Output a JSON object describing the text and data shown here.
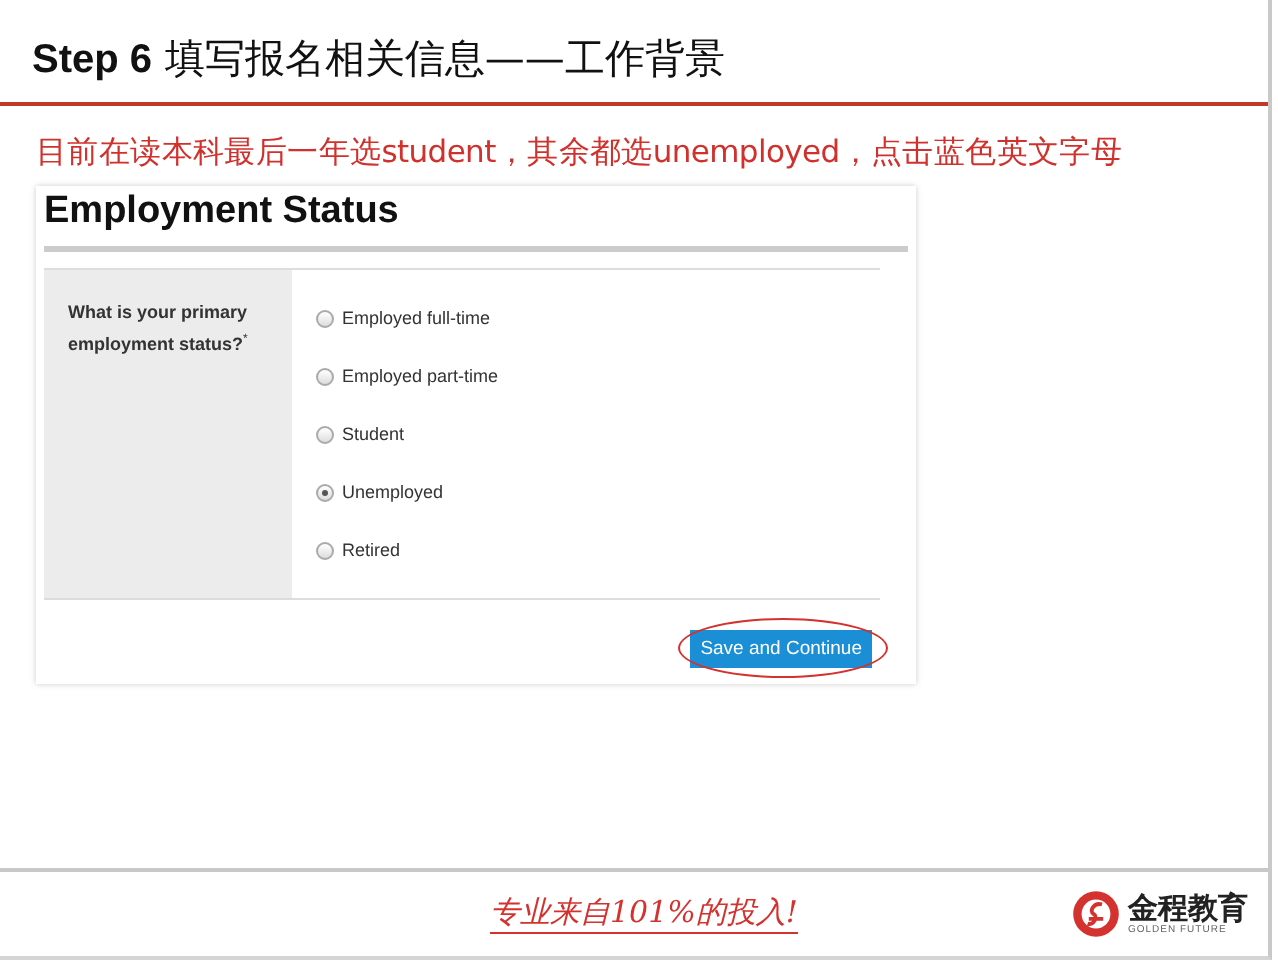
{
  "slide_title": {
    "step": "Step 6",
    "text": "填写报名相关信息——工作背景"
  },
  "instruction": "目前在读本科最后一年选student，其余都选unemployed，点击蓝色英文字母",
  "form": {
    "heading": "Employment Status",
    "question": "What is your primary employment status?",
    "required_mark": "*",
    "options": [
      {
        "label": "Employed full-time",
        "selected": false
      },
      {
        "label": "Employed part-time",
        "selected": false
      },
      {
        "label": "Student",
        "selected": false
      },
      {
        "label": "Unemployed",
        "selected": true
      },
      {
        "label": "Retired",
        "selected": false
      }
    ],
    "button": {
      "label": "Save and Continue",
      "circled": true
    }
  },
  "footer": {
    "slogan": "专业来自101%的投入!",
    "brand": "金程教育",
    "brand_sub": "GOLDEN FUTURE"
  }
}
